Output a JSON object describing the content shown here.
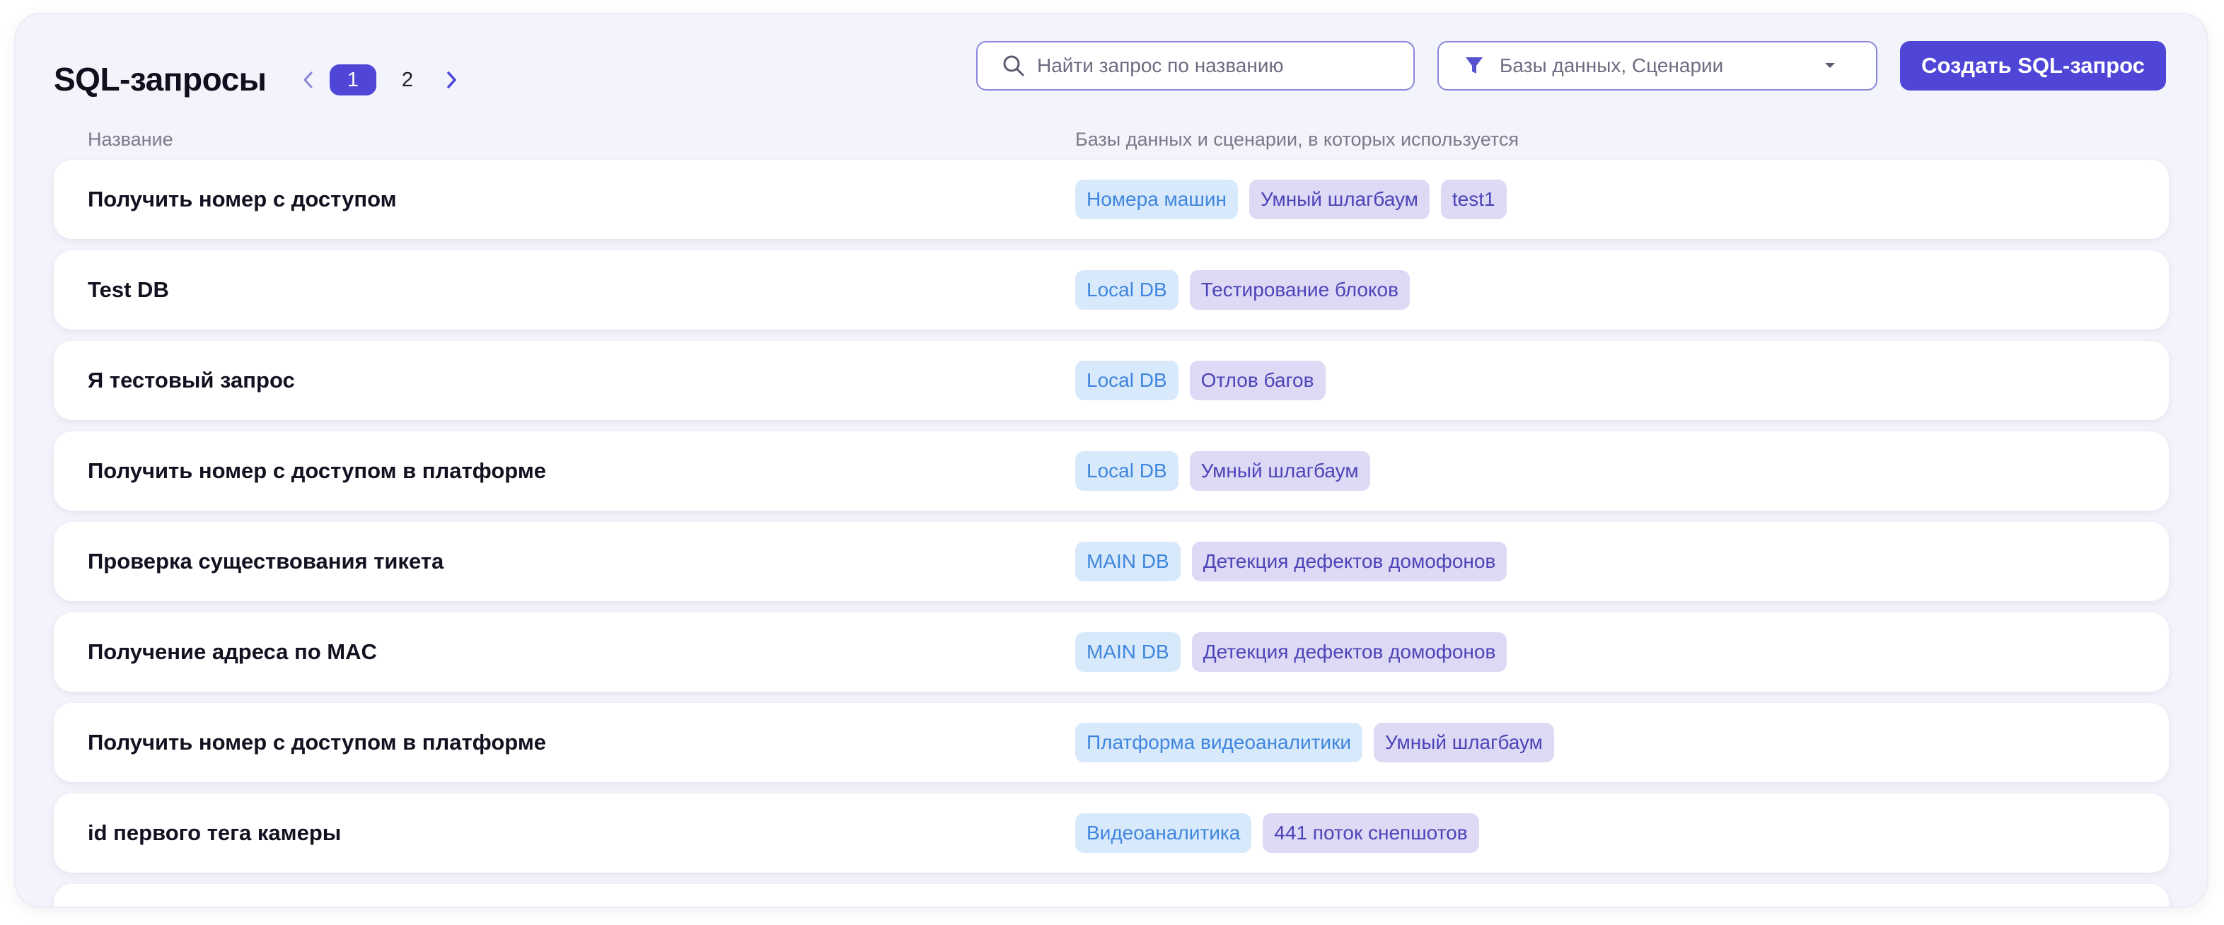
{
  "header": {
    "title": "SQL-запросы",
    "pagination": {
      "pages": [
        "1",
        "2"
      ],
      "current": "1",
      "prev_icon": "chevron-left-icon",
      "next_icon": "chevron-right-icon"
    },
    "search": {
      "placeholder": "Найти запрос по названию",
      "icon": "search-icon"
    },
    "filter": {
      "value": "Базы данных, Сценарии",
      "icon": "funnel-icon",
      "caret_icon": "caret-down-icon"
    },
    "create_button": "Создать SQL-запрос"
  },
  "table": {
    "columns": [
      "Название",
      "Базы данных и сценарии, в которых используется"
    ],
    "rows": [
      {
        "name": "Получить номер с доступом",
        "tags": [
          {
            "label": "Номера машин",
            "kind": "db"
          },
          {
            "label": "Умный шлагбаум",
            "kind": "scenario"
          },
          {
            "label": "test1",
            "kind": "scenario"
          }
        ]
      },
      {
        "name": "Test DB",
        "tags": [
          {
            "label": "Local DB",
            "kind": "db"
          },
          {
            "label": "Тестирование блоков",
            "kind": "scenario"
          }
        ]
      },
      {
        "name": "Я тестовый запрос",
        "tags": [
          {
            "label": "Local DB",
            "kind": "db"
          },
          {
            "label": "Отлов багов",
            "kind": "scenario"
          }
        ]
      },
      {
        "name": "Получить номер с доступом в платформе",
        "tags": [
          {
            "label": "Local DB",
            "kind": "db"
          },
          {
            "label": "Умный шлагбаум",
            "kind": "scenario"
          }
        ]
      },
      {
        "name": "Проверка существования тикета",
        "tags": [
          {
            "label": "MAIN DB",
            "kind": "db"
          },
          {
            "label": "Детекция дефектов домофонов",
            "kind": "scenario"
          }
        ]
      },
      {
        "name": "Получение адреса по MAC",
        "tags": [
          {
            "label": "MAIN DB",
            "kind": "db"
          },
          {
            "label": "Детекция дефектов домофонов",
            "kind": "scenario"
          }
        ]
      },
      {
        "name": "Получить номер с доступом в платформе",
        "tags": [
          {
            "label": "Платформа видеоаналитики",
            "kind": "db"
          },
          {
            "label": "Умный шлагбаум",
            "kind": "scenario"
          }
        ]
      },
      {
        "name": "id первого тега камеры",
        "tags": [
          {
            "label": "Видеоаналитика",
            "kind": "db"
          },
          {
            "label": "441 поток снепшотов",
            "kind": "scenario"
          }
        ]
      }
    ]
  },
  "colors": {
    "accent": "#4f46d8",
    "db_tag_bg": "#d8e9fb",
    "db_tag_text": "#3f86de",
    "scenario_tag_bg": "#dedaf5",
    "scenario_tag_text": "#4c44b8",
    "panel_bg": "#f3f3fb"
  }
}
